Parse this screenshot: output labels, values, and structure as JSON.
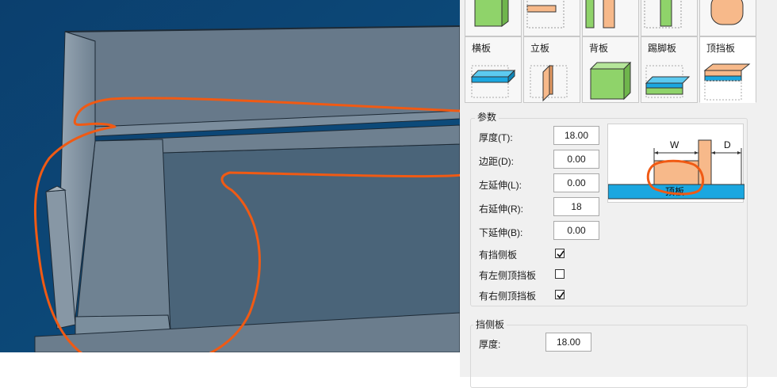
{
  "tabs_top": [
    {
      "icon": "green-cube-icon"
    },
    {
      "icon": "horizontal-board-icon"
    },
    {
      "icon": "vertical-board-icon"
    },
    {
      "icon": "dashed-board-icon"
    },
    {
      "icon": "cylinder-board-icon"
    }
  ],
  "tabs": [
    {
      "label": "横板",
      "icon": "blue-horizontal-board-icon"
    },
    {
      "label": "立板",
      "icon": "orange-vertical-board-icon"
    },
    {
      "label": "背板",
      "icon": "green-back-board-icon"
    },
    {
      "label": "踢脚板",
      "icon": "kick-board-icon"
    },
    {
      "label": "顶挡板",
      "icon": "top-baffle-icon",
      "active": true
    }
  ],
  "params": {
    "title": "参数",
    "fields": [
      {
        "label": "厚度(T):",
        "value": "18.00"
      },
      {
        "label": "边距(D):",
        "value": "0.00"
      },
      {
        "label": "左延伸(L):",
        "value": "0.00"
      },
      {
        "label": "右延伸(R):",
        "value": "18"
      },
      {
        "label": "下延伸(B):",
        "value": "0.00"
      }
    ],
    "checkboxes": [
      {
        "label": "有挡侧板",
        "checked": true
      },
      {
        "label": "有左侧顶挡板",
        "checked": false
      },
      {
        "label": "有右侧顶挡板",
        "checked": true
      }
    ]
  },
  "diagram": {
    "w_label": "W",
    "d_label": "D",
    "base_label": "顶板"
  },
  "side_group": {
    "title": "挡侧板",
    "thickness_label": "厚度:",
    "thickness_value": "18.00"
  },
  "colors": {
    "viewport_bg": "#0e4a78",
    "annotation": "#f05a14",
    "accent_orange": "#f7b98a",
    "accent_blue": "#1ba7e0",
    "accent_green": "#8fd36a"
  }
}
